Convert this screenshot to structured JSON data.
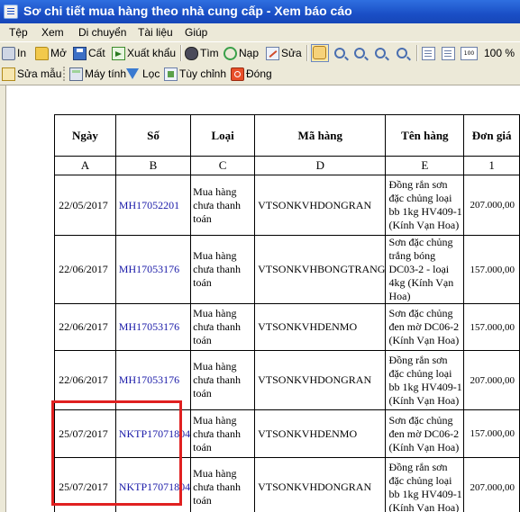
{
  "window": {
    "title": "Sơ chi tiết mua hàng theo nhà cung cấp - Xem báo cáo"
  },
  "menu": [
    {
      "label": "Tệp"
    },
    {
      "label": "Xem"
    },
    {
      "label": "Di chuyển"
    },
    {
      "label": "Tài liệu"
    },
    {
      "label": "Giúp"
    }
  ],
  "toolbar1": {
    "print": "In",
    "open": "Mở",
    "save": "Cất",
    "export": "Xuất khẩu",
    "find": "Tìm",
    "load": "Nạp",
    "edit": "Sửa",
    "zoom": "100 %"
  },
  "toolbar2": {
    "edit_template": "Sửa mẫu",
    "calculator": "Máy tính",
    "filter": "Lọc",
    "customize": "Tùy chỉnh",
    "close": "Đóng"
  },
  "report": {
    "header_cutoff": "",
    "columns": [
      {
        "title": "Ngày",
        "letter": "A"
      },
      {
        "title": "Số",
        "letter": "B"
      },
      {
        "title": "Loại",
        "letter": "C"
      },
      {
        "title": "Mã hàng",
        "letter": "D"
      },
      {
        "title": "Tên hàng",
        "letter": "E"
      },
      {
        "title": "Đơn giá",
        "letter": "1"
      }
    ],
    "rows": [
      {
        "date": "22/05/2017",
        "number": "MH17052201",
        "type": "Mua hàng chưa thanh toán",
        "code": "VTSONKVHDONGRAN",
        "name": "Đồng rắn sơn đặc chủng loại bb 1kg HV409-1 (Kính Vạn Hoa)",
        "price": "207.000,00"
      },
      {
        "date": "22/06/2017",
        "number": "MH17053176",
        "type": "Mua hàng chưa thanh toán",
        "code": "VTSONKVHBONGTRANG",
        "name": "Sơn đặc chủng trắng bóng DC03-2 - loại 4kg (Kính Vạn Hoa)",
        "price": "157.000,00"
      },
      {
        "date": "22/06/2017",
        "number": "MH17053176",
        "type": "Mua hàng chưa thanh toán",
        "code": "VTSONKVHDENMO",
        "name": "Sơn đặc chủng đen mờ DC06-2 (Kính Vạn Hoa)",
        "price": "157.000,00"
      },
      {
        "date": "22/06/2017",
        "number": "MH17053176",
        "type": "Mua hàng chưa thanh toán",
        "code": "VTSONKVHDONGRAN",
        "name": "Đồng rắn sơn đặc chủng loại bb 1kg HV409-1 (Kính Vạn Hoa)",
        "price": "207.000,00"
      },
      {
        "date": "25/07/2017",
        "number": "NKTP17071804",
        "type": "Mua hàng chưa thanh toán",
        "code": "VTSONKVHDENMO",
        "name": "Sơn đặc chủng đen mờ DC06-2 (Kính Vạn Hoa)",
        "price": "157.000,00"
      },
      {
        "date": "25/07/2017",
        "number": "NKTP17071804",
        "type": "Mua hàng chưa thanh toán",
        "code": "VTSONKVHDONGRAN",
        "name": "Đồng rắn sơn đặc chủng loại bb 1kg HV409-1 (Kính Vạn Hoa)",
        "price": "207.000,00"
      }
    ]
  },
  "colors": {
    "titlebar": "#1a4fc6",
    "chrome": "#ece9d8",
    "doc_link": "#1a1aa8",
    "highlight": "#e02020"
  }
}
